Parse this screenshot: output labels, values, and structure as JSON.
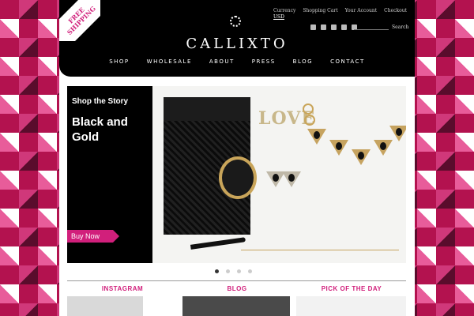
{
  "badge": {
    "line1": "FREE",
    "line2": "SHIPPING"
  },
  "top_links": {
    "currency_label": "Currency",
    "currency_value": "USD",
    "cart": "Shopping Cart",
    "account": "Your Account",
    "checkout": "Checkout"
  },
  "social_icons": [
    "facebook-icon",
    "twitter-icon",
    "pinterest-icon",
    "instagram-icon",
    "google-plus-icon"
  ],
  "search": {
    "button": "Search"
  },
  "brand": {
    "name": "CALLIXTO"
  },
  "nav": [
    {
      "label": "SHOP"
    },
    {
      "label": "WHOLESALE"
    },
    {
      "label": "ABOUT"
    },
    {
      "label": "PRESS"
    },
    {
      "label": "BLOG"
    },
    {
      "label": "CONTACT"
    }
  ],
  "hero": {
    "kicker": "Shop the Story",
    "title": "Black and Gold",
    "cta": "Buy Now",
    "photo_text": "LOVE"
  },
  "slider": {
    "count": 4,
    "active": 1
  },
  "sections": [
    {
      "title": "INSTAGRAM"
    },
    {
      "title": "BLOG"
    },
    {
      "title": "PICK OF THE DAY"
    }
  ],
  "colors": {
    "accent": "#d11f7b",
    "header": "#000000",
    "gold": "#c6a360"
  }
}
